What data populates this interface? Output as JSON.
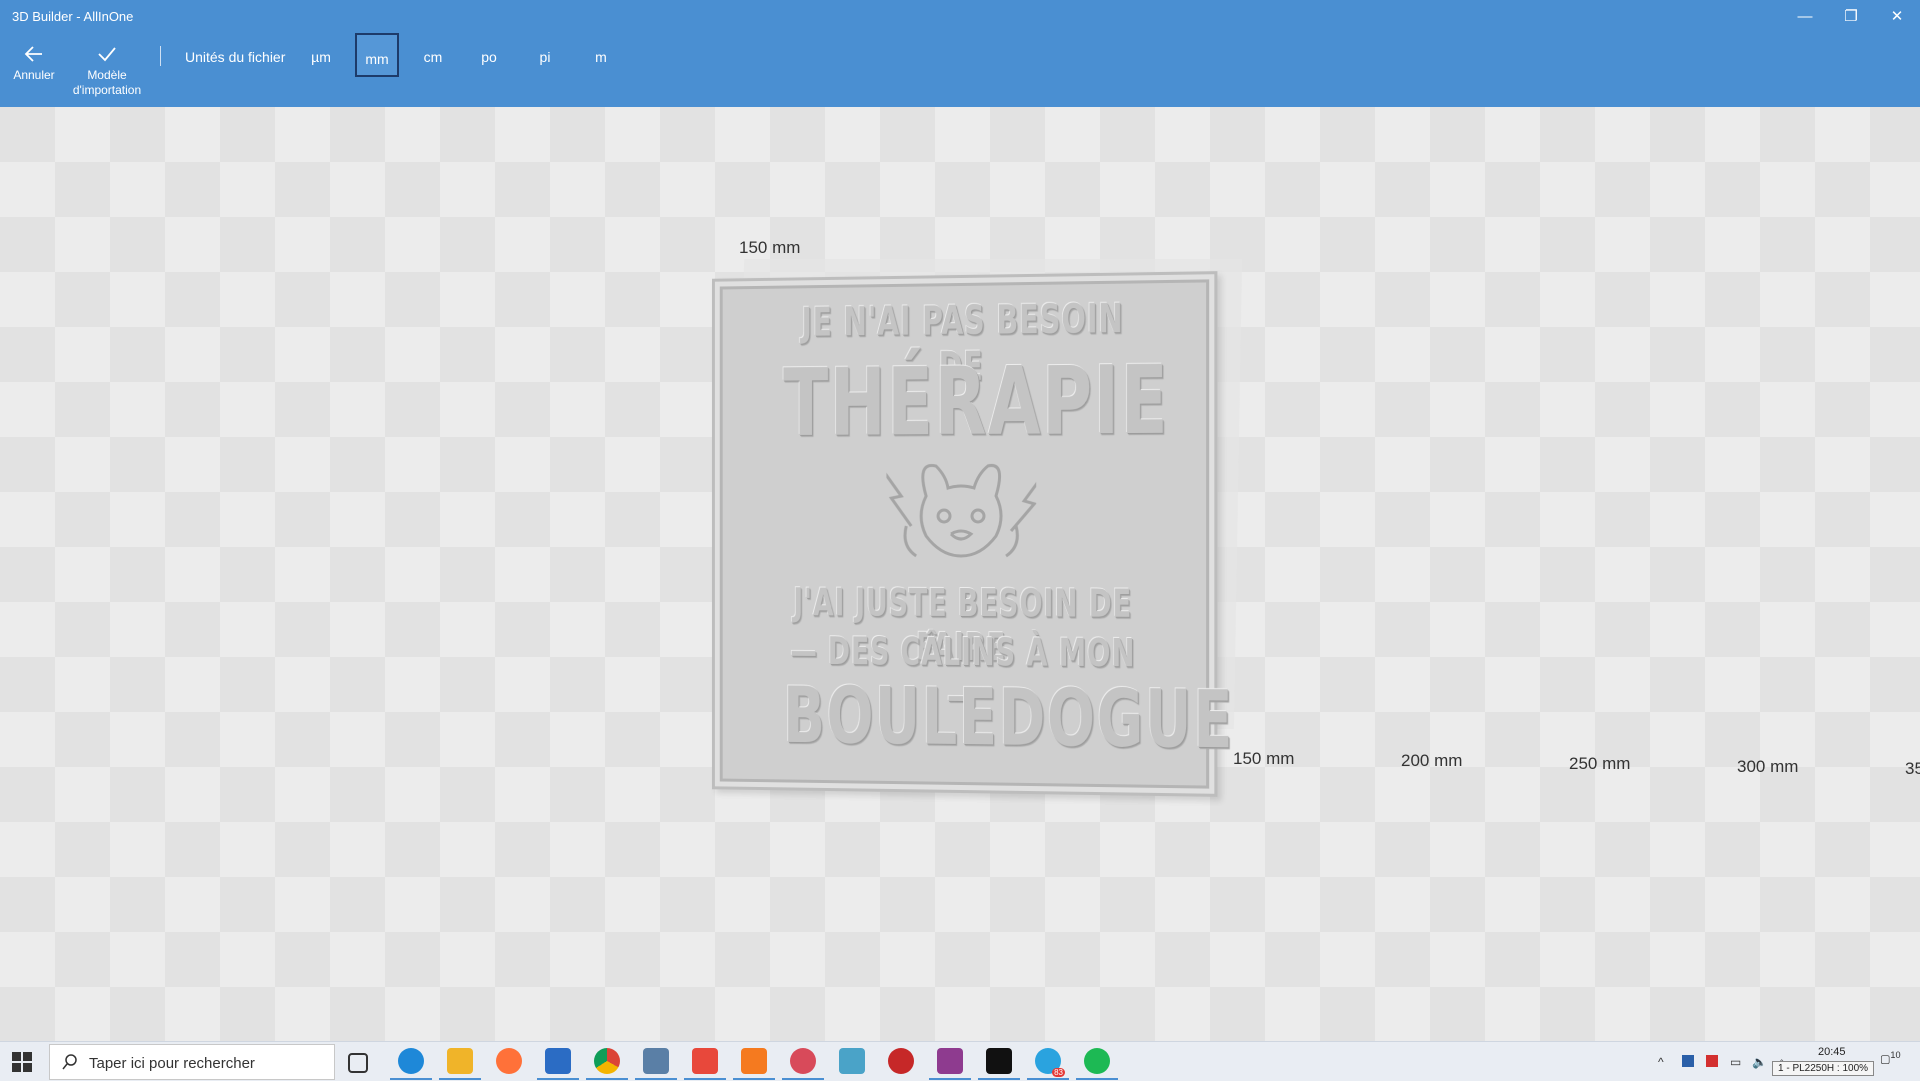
{
  "window": {
    "title": "3D Builder - AllInOne",
    "minimize": "—",
    "restore": "❐",
    "close": "✕"
  },
  "toolbar": {
    "cancel_label": "Annuler",
    "import_label_1": "Modèle",
    "import_label_2": "d'importation",
    "units_label": "Unités du fichier",
    "units": [
      "µm",
      "mm",
      "cm",
      "po",
      "pi",
      "m"
    ],
    "selected_unit": "mm"
  },
  "viewport": {
    "ruler_top": "150 mm",
    "ruler_x": [
      "150 mm",
      "200 mm",
      "250 mm",
      "300 mm",
      "35"
    ]
  },
  "model": {
    "line1": "JE N'AI PAS BESOIN DE",
    "line2": "THÉRAPIE",
    "line3": "J'AI JUSTE BESOIN DE FAIRE",
    "line4": "— DES CÂLINS À MON —",
    "line5": "BOULEDOGUE"
  },
  "taskbar": {
    "search_placeholder": "Taper ici pour rechercher",
    "time": "20:45",
    "tooltip": "1 - PL2250H : 100%",
    "notification_count": "10",
    "telegram_badge": "83",
    "app_icons": [
      "task-view-icon",
      "edge-icon",
      "file-explorer-icon",
      "firefox-icon",
      "mail-icon",
      "chrome-icon",
      "app-icon",
      "anydesk-icon",
      "flstudio-icon",
      "snipping-icon",
      "notepad-icon",
      "record-icon",
      "winrar-icon",
      "notion-icon",
      "telegram-icon",
      "spotify-icon"
    ]
  }
}
